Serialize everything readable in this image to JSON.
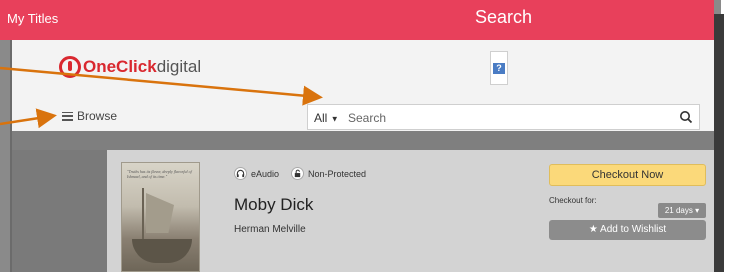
{
  "topbar": {
    "my_titles": "My Titles",
    "title": "Search"
  },
  "header": {
    "logo_brand": "OneClick",
    "logo_suffix": "digital",
    "help_icon": "?",
    "browse_label": "Browse",
    "search_scope": "All",
    "search_placeholder": "Search"
  },
  "title_card": {
    "cover_quote": "\"Truths has its flavor, deeply flavorful of Ishmael, and of its time.\"",
    "format_label": "eAudio",
    "protection_label": "Non-Protected",
    "title": "Moby Dick",
    "author": "Herman Melville",
    "checkout_button": "Checkout Now",
    "checkout_for_label": "Checkout for:",
    "checkout_days": "21 days",
    "wishlist_button": "Add to Wishlist"
  },
  "colors": {
    "topbar": "#e8405b",
    "checkout": "#fbd97a",
    "arrow": "#d9730d"
  },
  "icons": {
    "search": "search-icon",
    "hamburger": "menu-icon",
    "headphones": "headphones-icon",
    "unlock": "unlock-icon",
    "star": "star-icon"
  }
}
